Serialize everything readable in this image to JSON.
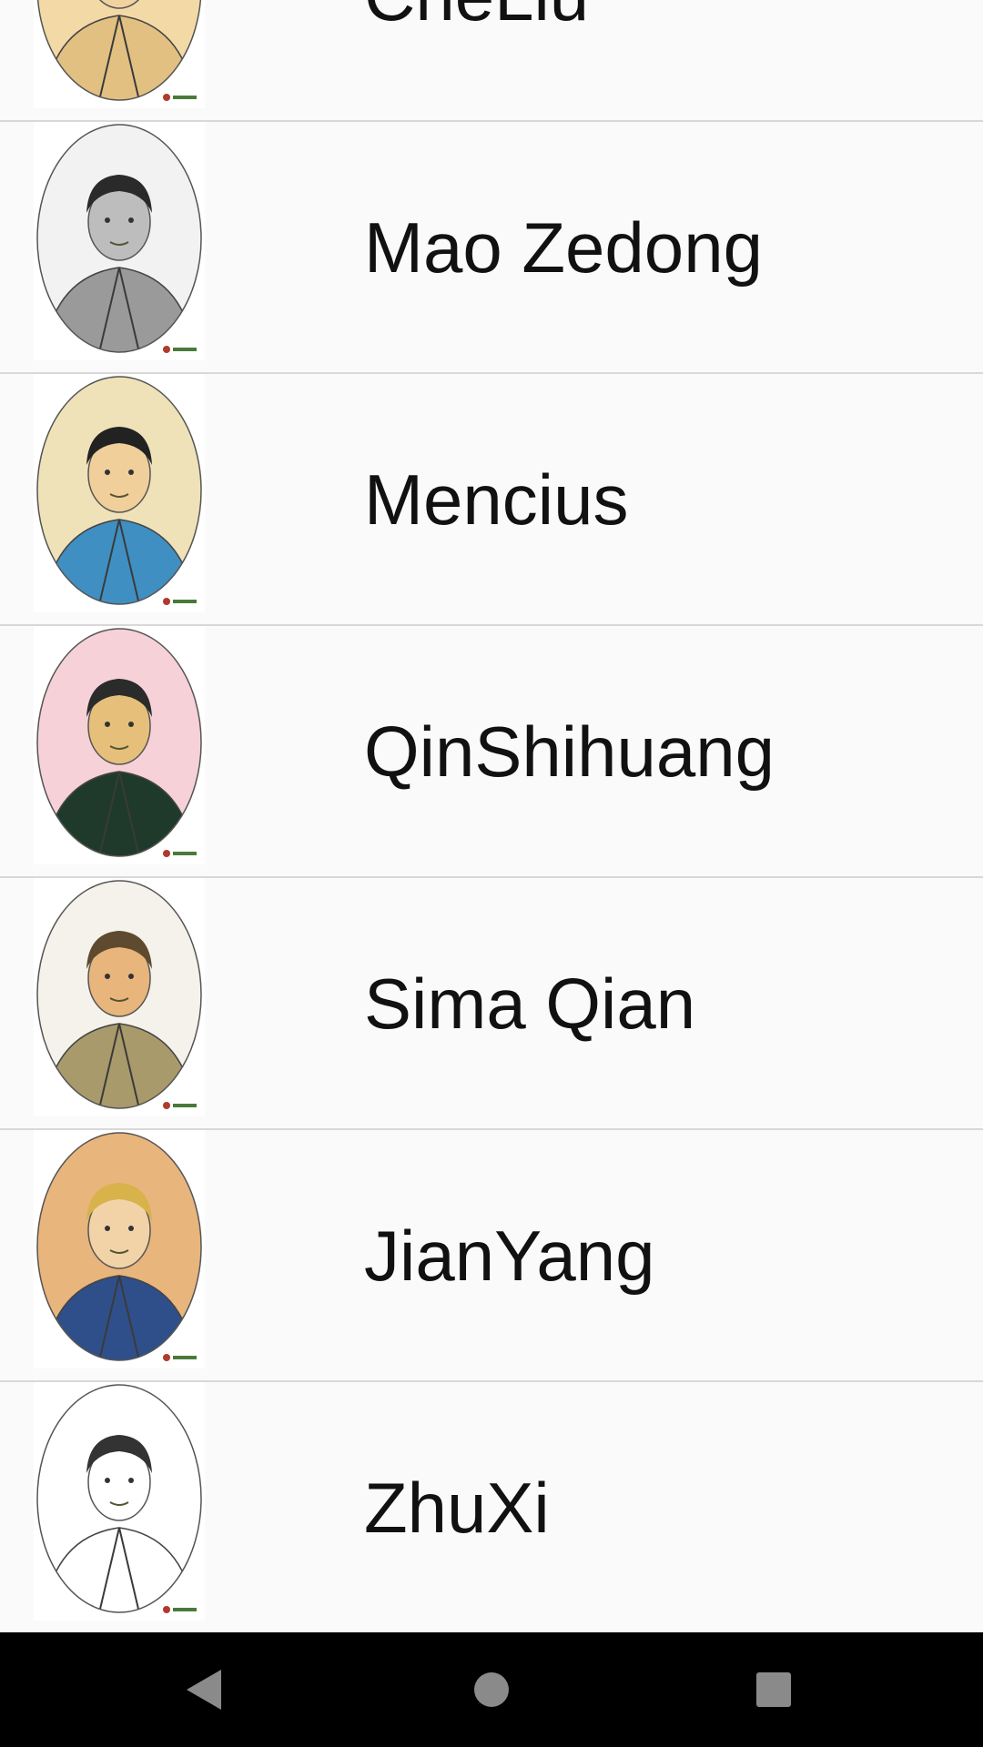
{
  "list": {
    "items": [
      {
        "name": "CheLiu",
        "portrait": "portrait-cheliu-icon",
        "bg": "#f3d9a6",
        "robe": "#e2c082",
        "skin": "#f1d3a0",
        "hair": "#6b5a3a"
      },
      {
        "name": "Mao Zedong",
        "portrait": "portrait-mao-zedong-icon",
        "bg": "#f2f2f2",
        "robe": "#9a9a9a",
        "skin": "#bdbdbd",
        "hair": "#2a2a2a"
      },
      {
        "name": "Mencius",
        "portrait": "portrait-mencius-icon",
        "bg": "#efe2b8",
        "robe": "#3f8fc2",
        "skin": "#f0cf9a",
        "hair": "#222222"
      },
      {
        "name": "QinShihuang",
        "portrait": "portrait-qinshihuang-icon",
        "bg": "#f6d1d8",
        "robe": "#1f3a2a",
        "skin": "#e6c07a",
        "hair": "#2b2b2b"
      },
      {
        "name": "Sima Qian",
        "portrait": "portrait-sima-qian-icon",
        "bg": "#f4f2ea",
        "robe": "#a89a6a",
        "skin": "#e8b57c",
        "hair": "#5e4a2e"
      },
      {
        "name": "JianYang",
        "portrait": "portrait-jianyang-icon",
        "bg": "#e8b57c",
        "robe": "#2f4f8a",
        "skin": "#f2d3a8",
        "hair": "#d8b24a"
      },
      {
        "name": "ZhuXi",
        "portrait": "portrait-zhuxi-icon",
        "bg": "#ffffff",
        "robe": "#ffffff",
        "skin": "#ffffff",
        "hair": "#333333"
      }
    ]
  },
  "navbar": {
    "back": "back-icon",
    "home": "home-icon",
    "recents": "recents-icon"
  }
}
